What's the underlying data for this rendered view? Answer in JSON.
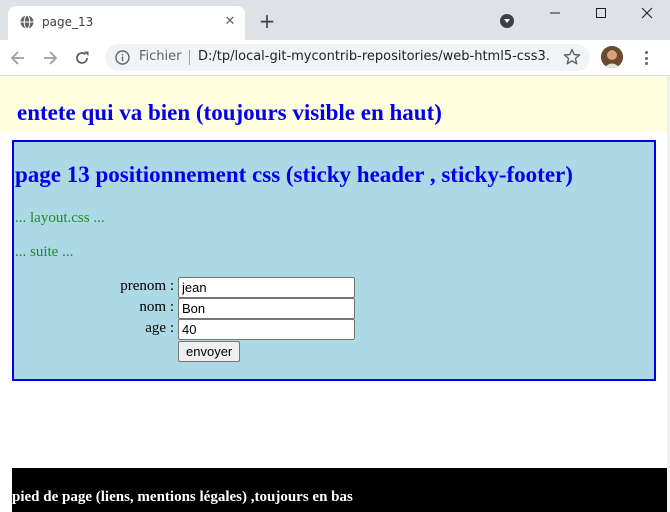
{
  "browser": {
    "tab_title": "page_13",
    "tab_close_glyph": "✕",
    "new_tab_glyph": "+",
    "site_info_label": "Fichier",
    "url": "D:/tp/local-git-mycontrib-repositories/web-html5-css3..."
  },
  "page": {
    "header_title": "entete qui va bien (toujours visible en haut)",
    "main_title": "page 13 positionnement css (sticky header , sticky-footer)",
    "paragraph_1": "... layout.css ...",
    "paragraph_2": "... suite ...",
    "form": {
      "prenom_label": "prenom :",
      "prenom_value": "jean",
      "nom_label": "nom :",
      "nom_value": "Bon",
      "age_label": "age :",
      "age_value": "40",
      "submit_label": "envoyer"
    },
    "footer_text": "pied de page (liens, mentions légales) ,toujours en bas"
  },
  "colors": {
    "header_bg": "#ffffe0",
    "main_bg": "#add8e6",
    "heading": "#0000ee",
    "paragraph": "#228b22",
    "footer_bg": "#000000",
    "footer_text": "#ffffff"
  },
  "icons": [
    "globe-icon",
    "close-icon",
    "plus-icon",
    "tab-search-icon",
    "minimize-icon",
    "maximize-icon",
    "window-close-icon",
    "back-arrow-icon",
    "forward-arrow-icon",
    "reload-icon",
    "info-icon",
    "star-icon",
    "avatar",
    "kebab-menu-icon"
  ]
}
